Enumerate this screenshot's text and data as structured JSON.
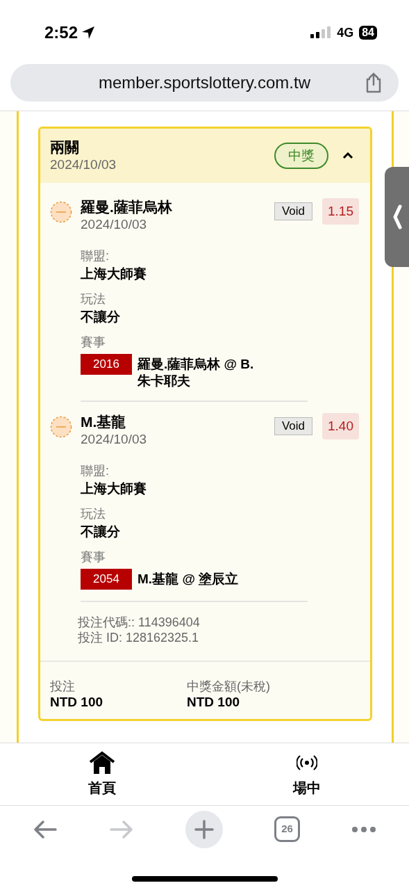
{
  "status_bar": {
    "time": "2:52",
    "network": "4G",
    "battery": "84"
  },
  "browser": {
    "url": "member.sportslottery.com.tw",
    "tab_count": "26"
  },
  "bet": {
    "type": "兩關",
    "date": "2024/10/03",
    "status": "中獎",
    "expanded": true,
    "legs": [
      {
        "title": "羅曼.薩菲烏林",
        "date": "2024/10/03",
        "result": "Void",
        "odds": "1.15",
        "league_label": "聯盟:",
        "league": "上海大師賽",
        "play_label": "玩法",
        "play": "不讓分",
        "event_label": "賽事",
        "event_code": "2016",
        "event": "羅曼.薩菲烏林 @ B. 朱卡耶夫"
      },
      {
        "title": "M.基龍",
        "date": "2024/10/03",
        "result": "Void",
        "odds": "1.40",
        "league_label": "聯盟:",
        "league": "上海大師賽",
        "play_label": "玩法",
        "play": "不讓分",
        "event_label": "賽事",
        "event_code": "2054",
        "event": "M.基龍 @ 塗辰立"
      }
    ],
    "codes": [
      "投注代碼:: 114396404",
      "投注 ID: 128162325.1"
    ],
    "stake_label": "投注",
    "stake": "NTD 100",
    "payout_label": "中獎金額(未稅)",
    "payout": "NTD 100"
  },
  "bottom_nav": [
    {
      "label": "首頁",
      "kind": "home"
    },
    {
      "label": "場中",
      "kind": "live"
    }
  ]
}
